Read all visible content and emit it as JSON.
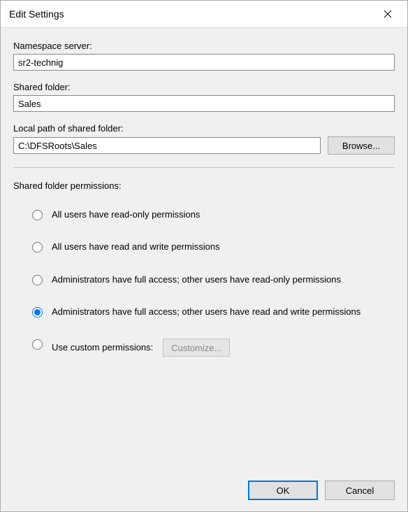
{
  "titlebar": {
    "title": "Edit Settings"
  },
  "fields": {
    "namespace_label": "Namespace server:",
    "namespace_value": "sr2-technig",
    "shared_label": "Shared folder:",
    "shared_value": "Sales",
    "local_label": "Local path of shared folder:",
    "local_value": "C:\\DFSRoots\\Sales",
    "browse_label": "Browse..."
  },
  "permissions": {
    "section_label": "Shared folder permissions:",
    "options": [
      "All users have read-only permissions",
      "All users have read and write permissions",
      "Administrators have full access; other users have read-only permissions",
      "Administrators have full access; other users have read and write permissions",
      "Use custom permissions:"
    ],
    "selected_index": 3,
    "customize_label": "Customize..."
  },
  "footer": {
    "ok_label": "OK",
    "cancel_label": "Cancel"
  }
}
